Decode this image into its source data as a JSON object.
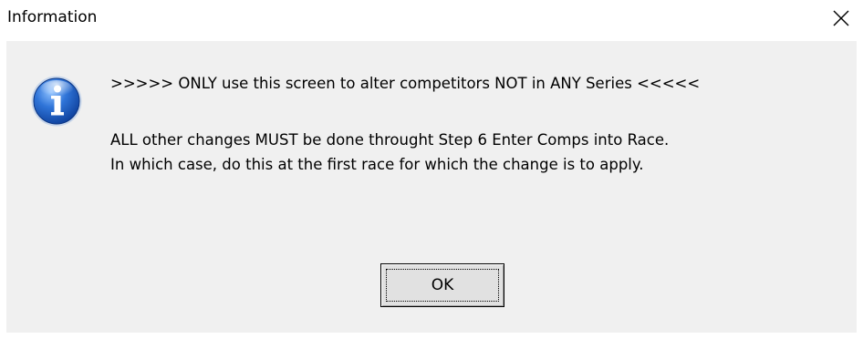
{
  "window": {
    "title": "Information",
    "close_icon": "close-icon"
  },
  "message": {
    "icon": "info-icon",
    "line1": ">>>>> ONLY use this screen to alter competitors NOT in ANY Series <<<<<",
    "line2": "ALL other changes MUST be done throught Step 6 Enter Comps into Race.",
    "line3": "In which case, do this at the first race for which the change is to apply."
  },
  "buttons": {
    "ok_label": "OK"
  },
  "colors": {
    "client_background": "#f0f0f0",
    "info_icon_blue": "#1f5fc4",
    "button_face": "#e1e1e1"
  }
}
